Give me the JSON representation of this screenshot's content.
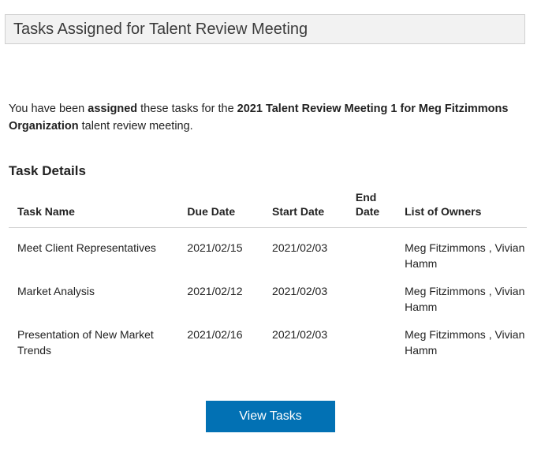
{
  "header": {
    "title": "Tasks Assigned for Talent Review Meeting"
  },
  "intro": {
    "part1": "You have been ",
    "bold1": "assigned",
    "part2": " these tasks for the ",
    "bold2": "2021 Talent Review Meeting 1 for Meg Fitzimmons Organization",
    "part3": " talent review meeting."
  },
  "section": {
    "heading": "Task Details"
  },
  "table": {
    "columns": [
      {
        "key": "task_name",
        "label": "Task Name"
      },
      {
        "key": "due_date",
        "label": "Due Date"
      },
      {
        "key": "start_date",
        "label": "Start Date"
      },
      {
        "key": "end_date",
        "label": "End Date"
      },
      {
        "key": "owners",
        "label": "List of Owners"
      }
    ],
    "rows": [
      {
        "task_name": "Meet Client Representatives",
        "due_date": "2021/02/15",
        "start_date": "2021/02/03",
        "end_date": "",
        "owners": "Meg Fitzimmons , Vivian Hamm"
      },
      {
        "task_name": "Market Analysis",
        "due_date": "2021/02/12",
        "start_date": "2021/02/03",
        "end_date": "",
        "owners": "Meg Fitzimmons , Vivian Hamm"
      },
      {
        "task_name": "Presentation of New Market Trends",
        "due_date": "2021/02/16",
        "start_date": "2021/02/03",
        "end_date": "",
        "owners": "Meg Fitzimmons , Vivian Hamm"
      }
    ]
  },
  "actions": {
    "view_tasks_label": "View Tasks"
  },
  "colors": {
    "button_background": "#0271b4",
    "button_text": "#ffffff",
    "header_background": "#f2f2f2",
    "header_border": "#cfcfcf",
    "text": "#222222",
    "divider": "#d3d3d3"
  }
}
